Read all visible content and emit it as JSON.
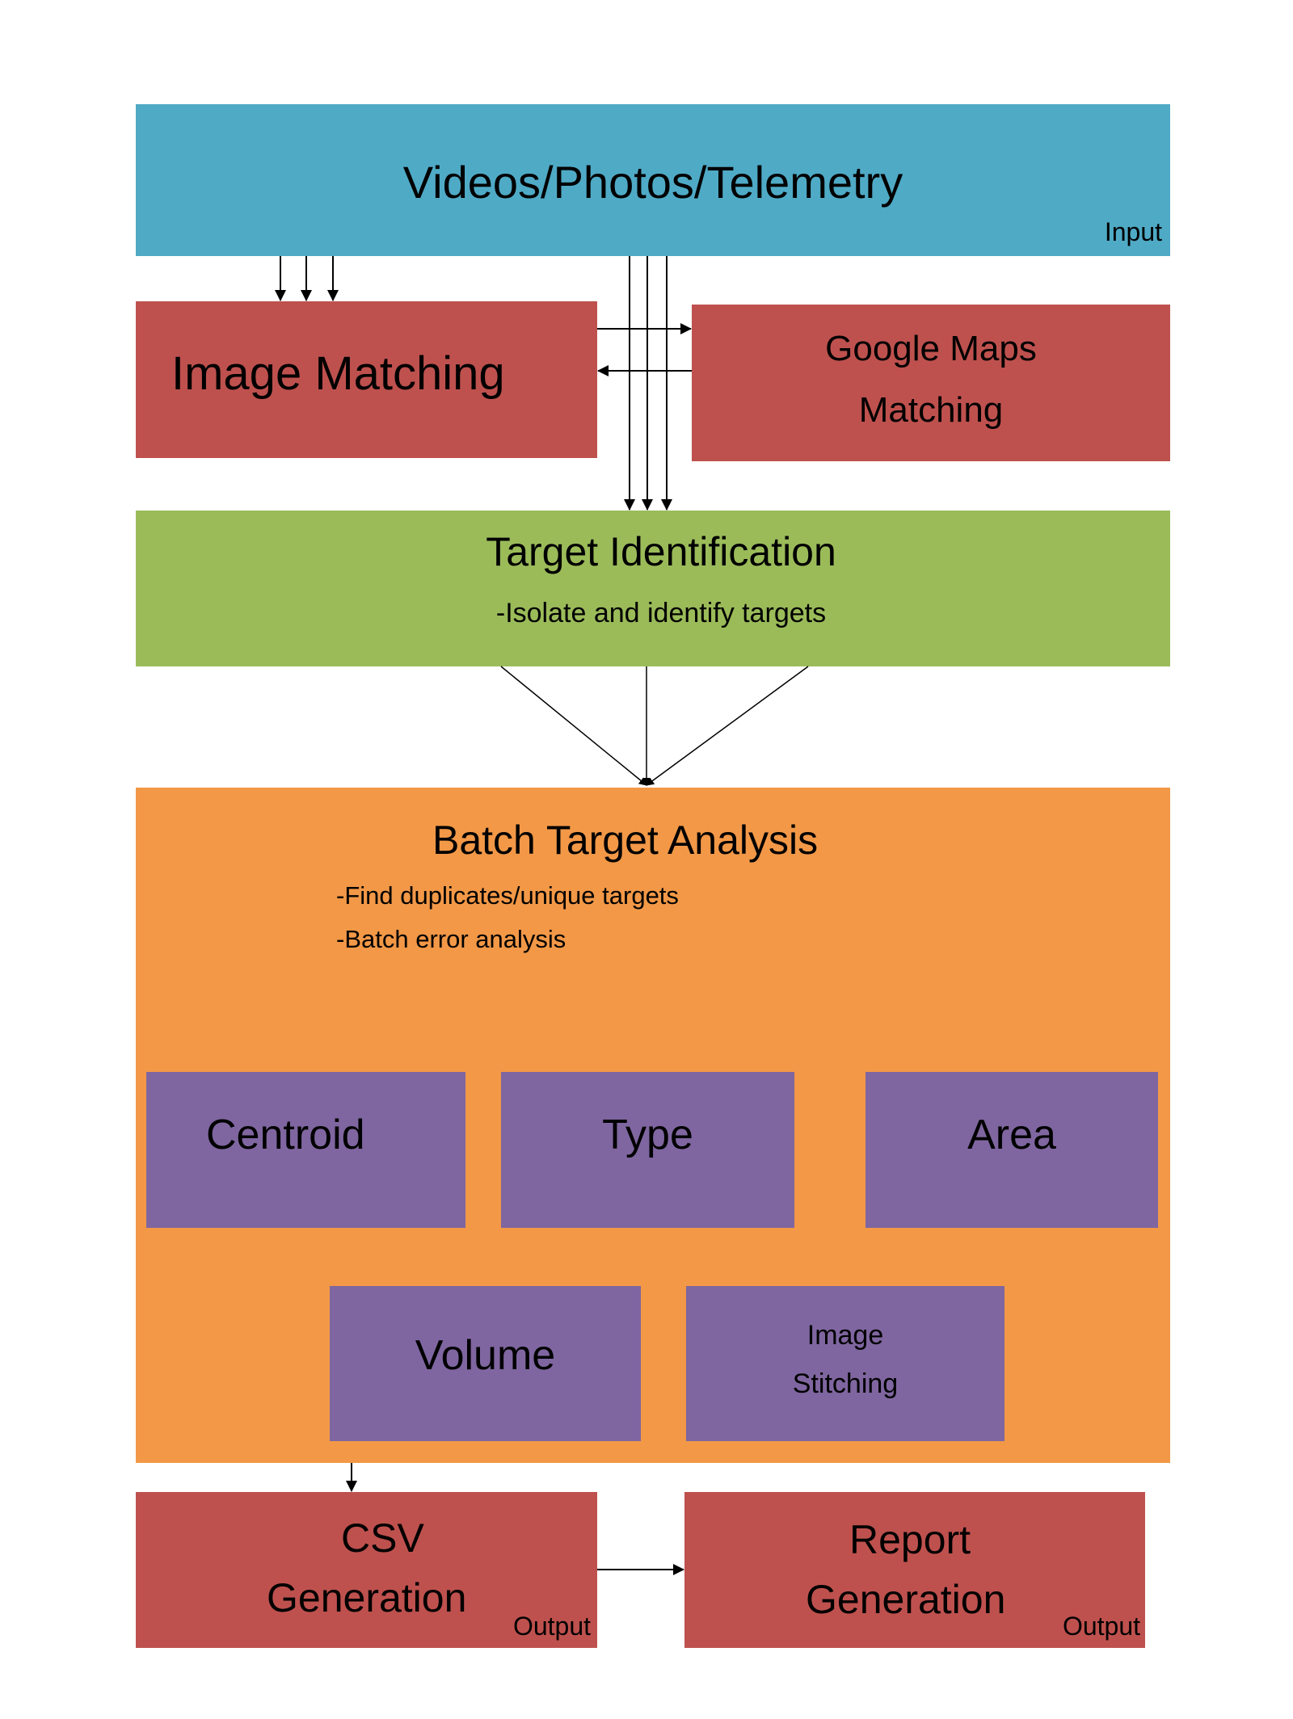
{
  "input_box": {
    "title": "Videos/Photos/Telemetry",
    "tag": "Input"
  },
  "image_matching": {
    "title": "Image Matching"
  },
  "google_maps": {
    "line1": "Google Maps",
    "line2": "Matching"
  },
  "target_identification": {
    "title": "Target Identification",
    "bullet": "-Isolate and identify targets"
  },
  "batch_analysis": {
    "title": "Batch Target Analysis",
    "bullets": [
      "-Find duplicates/unique targets",
      "-Batch error analysis"
    ],
    "modules": [
      "Centroid",
      "Type",
      "Area",
      "Volume"
    ],
    "stitching": {
      "line1": "Image",
      "line2": "Stitching"
    }
  },
  "csv": {
    "line1": "CSV",
    "line2": "Generation",
    "tag": "Output"
  },
  "report": {
    "line1": "Report",
    "line2": "Generation",
    "tag": "Output"
  },
  "colors": {
    "input": "#4FAAC6",
    "process": "#BE514E",
    "identification": "#9BBB59",
    "analysis": "#F29847",
    "module": "#7F66A0"
  }
}
